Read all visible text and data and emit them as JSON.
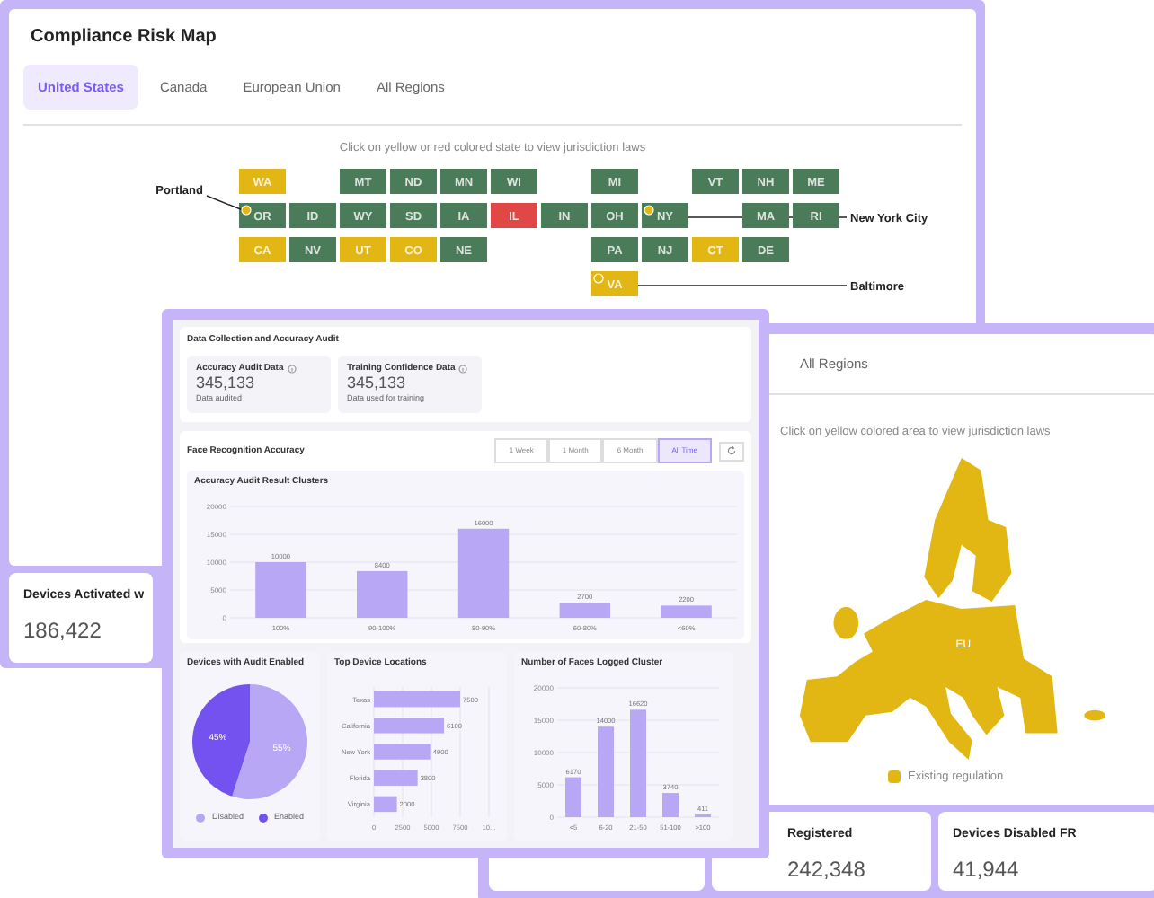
{
  "risk_map_window": {
    "title": "Compliance Risk Map",
    "tabs": [
      {
        "label": "United States",
        "selected": true
      },
      {
        "label": "Canada",
        "selected": false
      },
      {
        "label": "European Union",
        "selected": false
      },
      {
        "label": "All Regions",
        "selected": false
      }
    ],
    "hint": "Click on yellow or red colored state to view jurisdiction laws",
    "states": [
      {
        "label": "WA",
        "color": "#e2b714"
      },
      {
        "label": "MT",
        "color": "#4a7c59"
      },
      {
        "label": "ND",
        "color": "#4a7c59"
      },
      {
        "label": "MN",
        "color": "#4a7c59"
      },
      {
        "label": "WI",
        "color": "#4a7c59"
      },
      {
        "label": "MI",
        "color": "#4a7c59"
      },
      {
        "label": "VT",
        "color": "#4a7c59"
      },
      {
        "label": "NH",
        "color": "#4a7c59"
      },
      {
        "label": "ME",
        "color": "#4a7c59"
      },
      {
        "label": "OR",
        "color": "#4a7c59",
        "callout": "Portland"
      },
      {
        "label": "ID",
        "color": "#4a7c59"
      },
      {
        "label": "WY",
        "color": "#4a7c59"
      },
      {
        "label": "SD",
        "color": "#4a7c59"
      },
      {
        "label": "IA",
        "color": "#4a7c59"
      },
      {
        "label": "IL",
        "color": "#e04848"
      },
      {
        "label": "IN",
        "color": "#4a7c59"
      },
      {
        "label": "OH",
        "color": "#4a7c59"
      },
      {
        "label": "NY",
        "color": "#4a7c59",
        "callout": "New York City"
      },
      {
        "label": "MA",
        "color": "#4a7c59"
      },
      {
        "label": "RI",
        "color": "#4a7c59"
      },
      {
        "label": "CA",
        "color": "#e2b714"
      },
      {
        "label": "NV",
        "color": "#4a7c59"
      },
      {
        "label": "UT",
        "color": "#e2b714"
      },
      {
        "label": "CO",
        "color": "#e2b714"
      },
      {
        "label": "NE",
        "color": "#4a7c59"
      },
      {
        "label": "PA",
        "color": "#4a7c59"
      },
      {
        "label": "NJ",
        "color": "#4a7c59"
      },
      {
        "label": "CT",
        "color": "#e2b714"
      },
      {
        "label": "DE",
        "color": "#4a7c59"
      },
      {
        "label": "VA",
        "color": "#e2b714",
        "callout": "Baltimore"
      }
    ],
    "stat_cards": [
      {
        "label": "Devices Activated w",
        "value": "186,422"
      }
    ]
  },
  "audit_window": {
    "summary": {
      "title": "Data Collection and Accuracy Audit",
      "stats": [
        {
          "label": "Accuracy Audit Data",
          "value": "345,133",
          "caption": "Data audited"
        },
        {
          "label": "Training Confidence Data",
          "value": "345,133",
          "caption": "Data used for training"
        }
      ]
    },
    "accuracy": {
      "title": "Face Recognition Accuracy",
      "ranges": [
        {
          "label": "1 Week",
          "selected": false
        },
        {
          "label": "1 Month",
          "selected": false
        },
        {
          "label": "6 Month",
          "selected": false
        },
        {
          "label": "All Time",
          "selected": true
        }
      ],
      "chart_data": {
        "type": "bar",
        "title": "Accuracy Audit Result Clusters",
        "categories": [
          "100%",
          "90-100%",
          "80-90%",
          "60-80%",
          "<60%"
        ],
        "values": [
          10000,
          8400,
          16000,
          2700,
          2200
        ],
        "ylim": [
          0,
          20000
        ],
        "yticks": [
          0,
          5000,
          10000,
          15000,
          20000
        ],
        "grid": true,
        "data_labels": true
      }
    },
    "panels": [
      {
        "chart_data": {
          "type": "pie",
          "title": "Devices with Audit Enabled",
          "categories": [
            "Disabled",
            "Enabled"
          ],
          "values": [
            55,
            45
          ],
          "value_labels": [
            "55%",
            "45%"
          ],
          "legend": true
        }
      },
      {
        "chart_data": {
          "type": "bar",
          "orientation": "horizontal",
          "title": "Top Device Locations",
          "categories": [
            "Texas",
            "California",
            "New York",
            "Florida",
            "Virginia"
          ],
          "values": [
            7500,
            6100,
            4900,
            3800,
            2000
          ],
          "xlim": [
            0,
            10000
          ],
          "xticks": [
            0,
            2500,
            5000,
            7500,
            {
              "value": 10000,
              "label": "10..."
            }
          ],
          "grid": true,
          "data_labels": true
        }
      },
      {
        "chart_data": {
          "type": "bar",
          "title": "Number of Faces Logged Cluster",
          "categories": [
            "<5",
            "6-20",
            "21-50",
            "51-100",
            ">100"
          ],
          "values": [
            6170,
            14000,
            16620,
            3740,
            411
          ],
          "ylim": [
            0,
            20000
          ],
          "yticks": [
            0,
            5000,
            10000,
            15000,
            20000
          ],
          "grid": true,
          "data_labels": true
        }
      }
    ]
  },
  "eu_window": {
    "tabs": [
      {
        "label": "All Regions",
        "selected": false
      }
    ],
    "hint": "Click on yellow colored area to view jurisdiction laws",
    "map_label": "EU",
    "legend": "Existing regulation",
    "stat_cards": [
      {
        "label": "Registered",
        "value": "242,348"
      },
      {
        "label": "Devices Disabled FR",
        "value": "41,944"
      }
    ]
  }
}
